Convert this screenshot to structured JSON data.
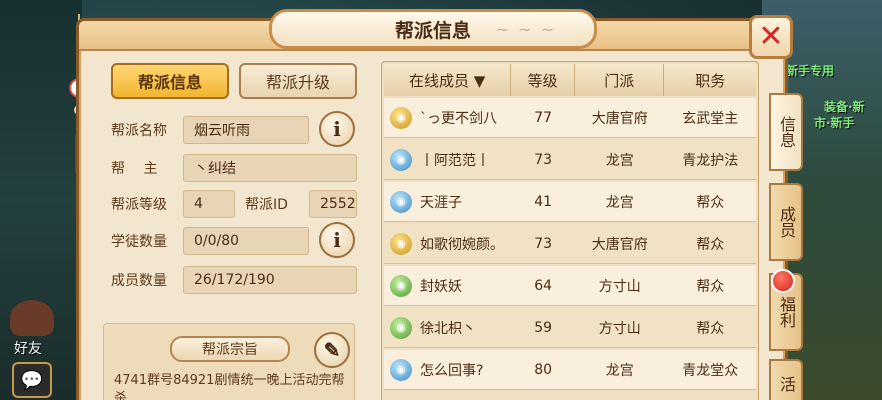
{
  "window": {
    "title": "帮派信息"
  },
  "left_tabs": {
    "active": "帮派信息",
    "inactive": "帮派升级"
  },
  "info": {
    "name_label": "帮派名称",
    "name_value": "烟云听雨",
    "leader_label": "帮　 主",
    "leader_value": "丶纠结",
    "level_label": "帮派等级",
    "level_value": "4",
    "id_label": "帮派ID",
    "id_value": "2552",
    "apprentice_label": "学徒数量",
    "apprentice_value": "0/0/80",
    "member_label": "成员数量",
    "member_value": "26/172/190"
  },
  "motto": {
    "label": "帮派宗旨",
    "text": "4741群号84921剧情统一晚上活动完帮杀"
  },
  "table": {
    "headers": [
      "在线成员 ▼",
      "等级",
      "门派",
      "职务"
    ],
    "rows": [
      {
        "icon": "gold",
        "name": "`っ更不剑八",
        "level": "77",
        "sect": "大唐官府",
        "role": "玄武堂主"
      },
      {
        "icon": "blue",
        "name": "丨阿范范丨",
        "level": "73",
        "sect": "龙宫",
        "role": "青龙护法"
      },
      {
        "icon": "blue",
        "name": "天涯子",
        "level": "41",
        "sect": "龙宫",
        "role": "帮众"
      },
      {
        "icon": "gold",
        "name": "如歌彻婉颜。",
        "level": "73",
        "sect": "大唐官府",
        "role": "帮众"
      },
      {
        "icon": "green",
        "name": "封妖妖",
        "level": "64",
        "sect": "方寸山",
        "role": "帮众"
      },
      {
        "icon": "green",
        "name": "徐北枳丶",
        "level": "59",
        "sect": "方寸山",
        "role": "帮众"
      },
      {
        "icon": "blue",
        "name": "怎么回事?",
        "level": "80",
        "sect": "龙宫",
        "role": "青龙堂众"
      }
    ]
  },
  "side_tabs": [
    "信息",
    "成员",
    "福利",
    "活"
  ],
  "background": {
    "text1": "新手专用",
    "text2": "装备·新",
    "text3": "市·新手",
    "friend_label": "好友"
  },
  "colors": {
    "accent_gold": "#f1b531",
    "close_red": "#d82424",
    "panel": "#f3e6cf"
  }
}
